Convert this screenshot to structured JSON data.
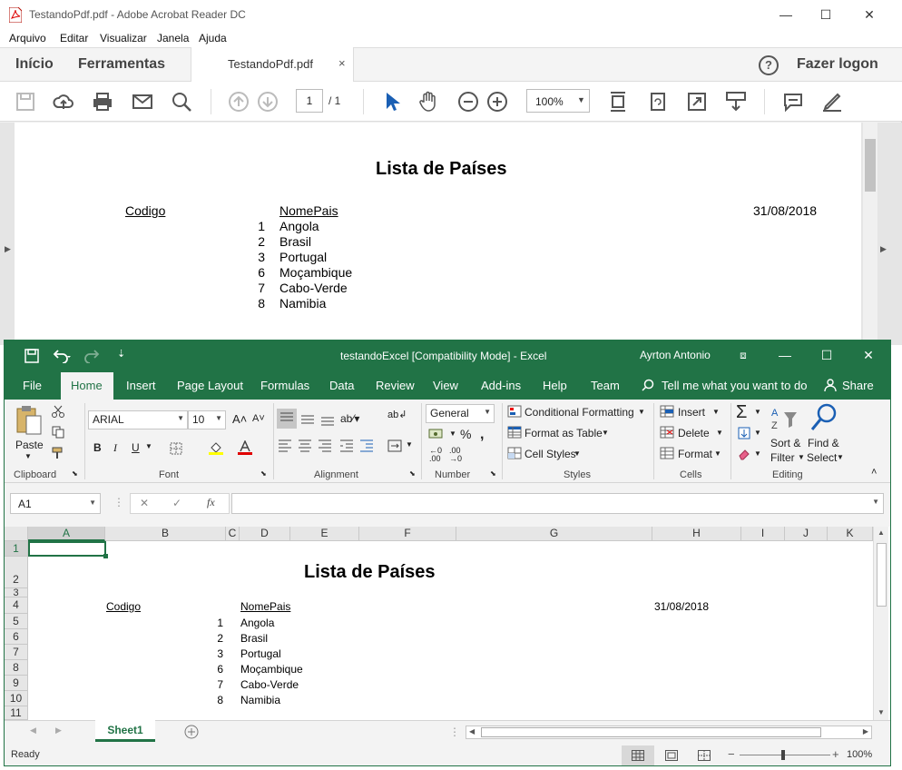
{
  "acrobat": {
    "window_title": "TestandoPdf.pdf - Adobe Acrobat Reader DC",
    "menu": [
      "Arquivo",
      "Editar",
      "Visualizar",
      "Janela",
      "Ajuda"
    ],
    "tabs": {
      "home": "Início",
      "tools": "Ferramentas",
      "document": "TestandoPdf.pdf",
      "close": "×"
    },
    "help": "?",
    "login": "Fazer logon",
    "page_current": "1",
    "page_total": "/ 1",
    "zoom": "100%",
    "document": {
      "title": "Lista de Países",
      "col_code": "Codigo",
      "col_name": "NomePais",
      "date": "31/08/2018",
      "rows": [
        {
          "code": "1",
          "name": "Angola"
        },
        {
          "code": "2",
          "name": "Brasil"
        },
        {
          "code": "3",
          "name": "Portugal"
        },
        {
          "code": "6",
          "name": "Moçambique"
        },
        {
          "code": "7",
          "name": "Cabo-Verde"
        },
        {
          "code": "8",
          "name": "Namibia"
        }
      ]
    }
  },
  "excel": {
    "title": "testandoExcel  [Compatibility Mode]  -  Excel",
    "user": "Ayrton Antonio",
    "ribbon_tabs": [
      "File",
      "Home",
      "Insert",
      "Page Layout",
      "Formulas",
      "Data",
      "Review",
      "View",
      "Add-ins",
      "Help",
      "Team"
    ],
    "tell_me": "Tell me what you want to do",
    "share": "Share",
    "clipboard": {
      "paste": "Paste",
      "label": "Clipboard"
    },
    "font": {
      "name": "ARIAL",
      "size": "10",
      "label": "Font"
    },
    "alignment_label": "Alignment",
    "number": {
      "format": "General",
      "label": "Number"
    },
    "styles": {
      "conditional": "Conditional Formatting",
      "table": "Format as Table",
      "cell_styles": "Cell Styles",
      "label": "Styles"
    },
    "cells": {
      "insert": "Insert",
      "delete": "Delete",
      "format": "Format",
      "label": "Cells"
    },
    "editing": {
      "sort": "Sort &",
      "filter": "Filter",
      "find": "Find &",
      "select": "Select",
      "label": "Editing"
    },
    "name_box": "A1",
    "columns": [
      "A",
      "B",
      "C",
      "D",
      "E",
      "F",
      "G",
      "H",
      "I",
      "J",
      "K"
    ],
    "rows": [
      "1",
      "2",
      "3",
      "4",
      "5",
      "6",
      "7",
      "8",
      "9",
      "10",
      "11"
    ],
    "sheet": {
      "title": "Lista de Países",
      "col_code": "Codigo",
      "col_name": "NomePais",
      "date": "31/08/2018",
      "rows": [
        {
          "code": "1",
          "name": "Angola"
        },
        {
          "code": "2",
          "name": "Brasil"
        },
        {
          "code": "3",
          "name": "Portugal"
        },
        {
          "code": "6",
          "name": "Moçambique"
        },
        {
          "code": "7",
          "name": "Cabo-Verde"
        },
        {
          "code": "8",
          "name": "Namibia"
        }
      ]
    },
    "sheet_tab": "Sheet1",
    "status": "Ready",
    "zoom": "100%"
  }
}
